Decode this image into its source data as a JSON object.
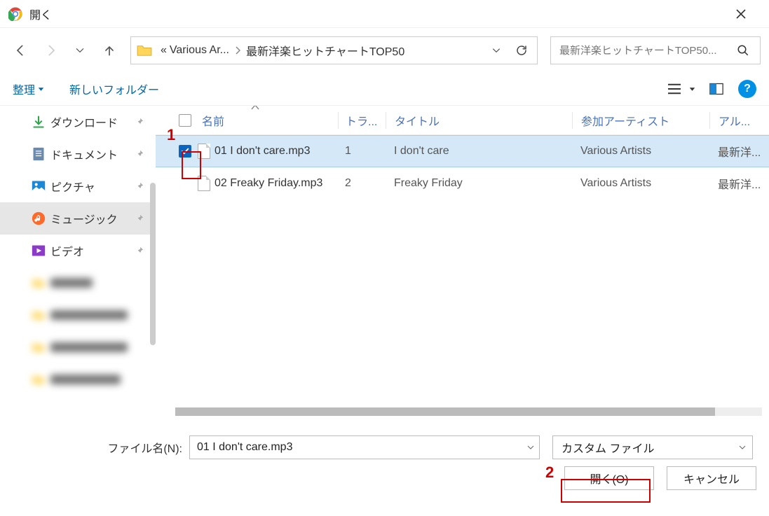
{
  "window": {
    "title": "開く"
  },
  "breadcrumb": {
    "prefix": "«",
    "parent": "Various Ar...",
    "current": "最新洋楽ヒットチャートTOP50"
  },
  "search": {
    "placeholder": "最新洋楽ヒットチャートTOP50..."
  },
  "toolbar": {
    "organize": "整理",
    "newfolder": "新しいフォルダー"
  },
  "columns": {
    "name": "名前",
    "track": "トラ...",
    "title": "タイトル",
    "artist": "参加アーティスト",
    "album": "アル..."
  },
  "sidebar": {
    "items": [
      {
        "label": "ダウンロード"
      },
      {
        "label": "ドキュメント"
      },
      {
        "label": "ピクチャ"
      },
      {
        "label": "ミュージック"
      },
      {
        "label": "ビデオ"
      }
    ]
  },
  "files": [
    {
      "checked": true,
      "name": "01 I don't care.mp3",
      "track": "1",
      "title": "I don't care",
      "artist": "Various Artists",
      "album": "最新洋..."
    },
    {
      "checked": false,
      "name": "02 Freaky Friday.mp3",
      "track": "2",
      "title": "Freaky Friday",
      "artist": "Various Artists",
      "album": "最新洋..."
    }
  ],
  "filerow": {
    "label": "ファイル名(N):",
    "value": "01 I don't care.mp3",
    "type": "カスタム ファイル"
  },
  "buttons": {
    "open": "開く(O)",
    "cancel": "キャンセル"
  },
  "annotations": {
    "one": "1",
    "two": "2"
  }
}
